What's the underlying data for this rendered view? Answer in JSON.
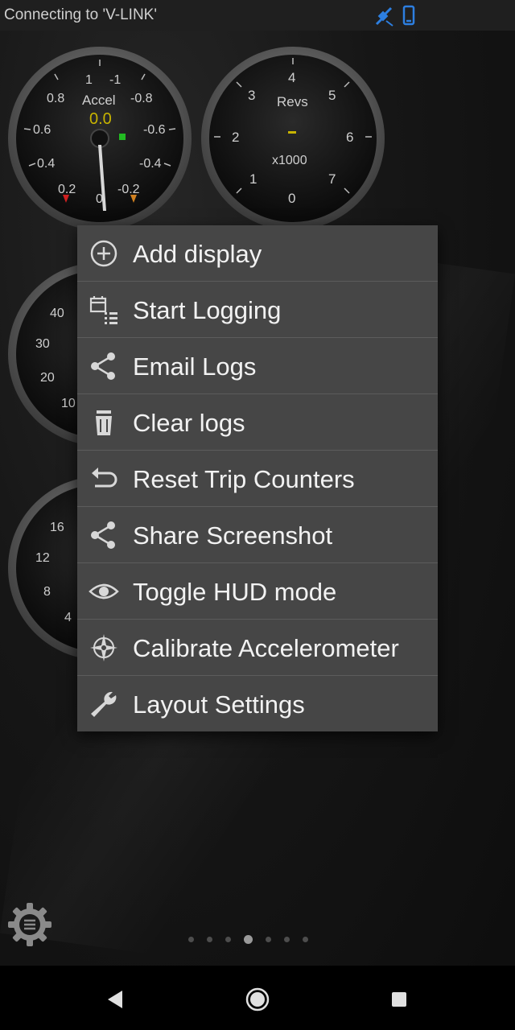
{
  "status_bar": {
    "text": "Connecting to 'V-LINK'",
    "icons": [
      "satellite-icon",
      "phone-icon"
    ],
    "icon_color": "#2d7fe0"
  },
  "gauges": {
    "accel": {
      "title": "Accel",
      "value": "0.0",
      "value_color": "#c8b400",
      "ticks": [
        "1",
        "-1",
        "0.8",
        "-0.8",
        "0.6",
        "-0.6",
        "0.4",
        "-0.4",
        "0.2",
        "-0.2",
        "0"
      ]
    },
    "revs": {
      "title": "Revs",
      "unit": "x1000",
      "ticks": [
        "4",
        "3",
        "5",
        "2",
        "6",
        "1",
        "7",
        "0"
      ]
    },
    "speed_partial": {
      "ticks": [
        "40",
        "30",
        "20",
        "10"
      ]
    },
    "boost_partial": {
      "ticks": [
        "16",
        "12",
        "8",
        "4"
      ]
    }
  },
  "menu": {
    "items": [
      {
        "label": "Add display",
        "icon": "add-circle-icon"
      },
      {
        "label": "Start Logging",
        "icon": "calendar-list-icon"
      },
      {
        "label": "Email Logs",
        "icon": "share-icon"
      },
      {
        "label": "Clear logs",
        "icon": "trash-icon"
      },
      {
        "label": "Reset Trip Counters",
        "icon": "undo-icon"
      },
      {
        "label": "Share Screenshot",
        "icon": "share-icon"
      },
      {
        "label": "Toggle HUD mode",
        "icon": "eye-icon"
      },
      {
        "label": "Calibrate Accelerometer",
        "icon": "compass-icon"
      },
      {
        "label": "Layout Settings",
        "icon": "wrench-icon"
      }
    ]
  },
  "page_indicator": {
    "count": 7,
    "active_index": 3
  },
  "nav_bar": {
    "buttons": [
      "back-icon",
      "home-icon",
      "recents-icon"
    ]
  }
}
